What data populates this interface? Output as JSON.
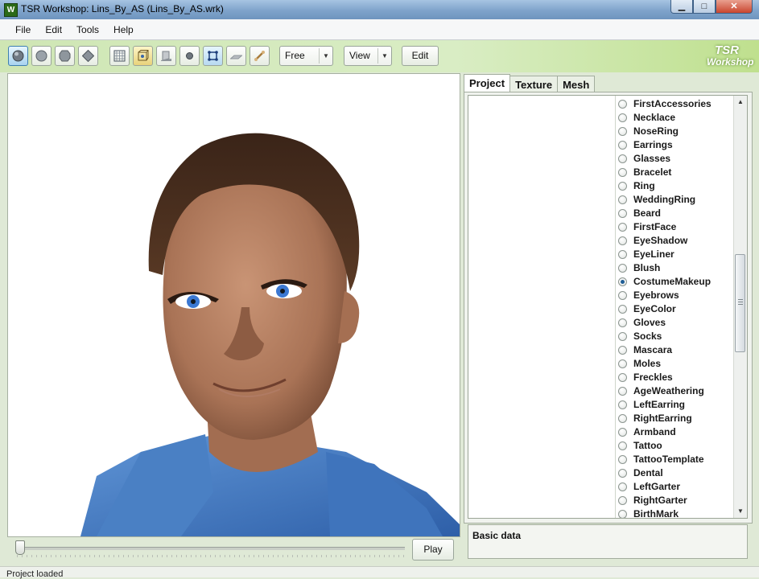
{
  "window": {
    "title": "TSR Workshop: Lins_By_AS (Lins_By_AS.wrk)",
    "app_icon_letter": "W",
    "minimize": "▁",
    "maximize": "□",
    "close": "✕"
  },
  "menu": [
    "File",
    "Edit",
    "Tools",
    "Help"
  ],
  "toolbar": {
    "icons": [
      "shaded-sphere-icon",
      "smooth-sphere-icon",
      "flat-sphere-icon",
      "diamond-icon",
      "grid-icon",
      "bone-box-icon",
      "plane-shadow-icon",
      "small-sphere-icon",
      "skeleton-icon",
      "plane-icon",
      "bone-icon"
    ],
    "camera_mode": "Free",
    "view_menu": "View",
    "edit_label": "Edit",
    "logo_line1": "TSR",
    "logo_line2": "Workshop"
  },
  "viewport": {
    "play_label": "Play",
    "timeline_position": 0
  },
  "tabs": [
    "Project",
    "Texture",
    "Mesh"
  ],
  "active_tab": "Project",
  "layers": [
    {
      "label": "FirstAccessories",
      "selected": false
    },
    {
      "label": "Necklace",
      "selected": false
    },
    {
      "label": "NoseRing",
      "selected": false
    },
    {
      "label": "Earrings",
      "selected": false
    },
    {
      "label": "Glasses",
      "selected": false
    },
    {
      "label": "Bracelet",
      "selected": false
    },
    {
      "label": "Ring",
      "selected": false
    },
    {
      "label": "WeddingRing",
      "selected": false
    },
    {
      "label": "Beard",
      "selected": false
    },
    {
      "label": "FirstFace",
      "selected": false
    },
    {
      "label": "EyeShadow",
      "selected": false
    },
    {
      "label": "EyeLiner",
      "selected": false
    },
    {
      "label": "Blush",
      "selected": false
    },
    {
      "label": "CostumeMakeup",
      "selected": true
    },
    {
      "label": "Eyebrows",
      "selected": false
    },
    {
      "label": "EyeColor",
      "selected": false
    },
    {
      "label": "Gloves",
      "selected": false
    },
    {
      "label": "Socks",
      "selected": false
    },
    {
      "label": "Mascara",
      "selected": false
    },
    {
      "label": "Moles",
      "selected": false
    },
    {
      "label": "Freckles",
      "selected": false
    },
    {
      "label": "AgeWeathering",
      "selected": false
    },
    {
      "label": "LeftEarring",
      "selected": false
    },
    {
      "label": "RightEarring",
      "selected": false
    },
    {
      "label": "Armband",
      "selected": false
    },
    {
      "label": "Tattoo",
      "selected": false
    },
    {
      "label": "TattooTemplate",
      "selected": false
    },
    {
      "label": "Dental",
      "selected": false
    },
    {
      "label": "LeftGarter",
      "selected": false
    },
    {
      "label": "RightGarter",
      "selected": false
    },
    {
      "label": "BirthMark",
      "selected": false
    }
  ],
  "basic_data_label": "Basic data",
  "status": "Project loaded"
}
